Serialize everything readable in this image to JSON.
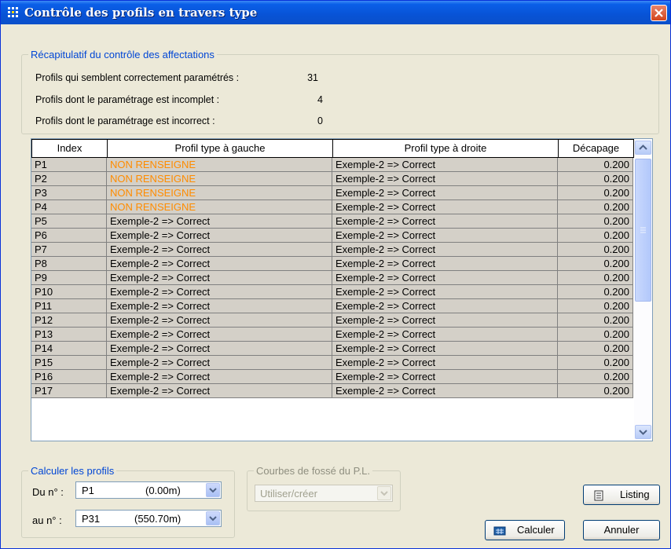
{
  "window": {
    "title": "Contrôle des profils en travers type",
    "accent": "#0a5fe8"
  },
  "summary": {
    "legend": "Récapitulatif du contrôle des affectations",
    "stats": [
      {
        "label": "Profils qui semblent correctement paramétrés :",
        "value": "31"
      },
      {
        "label": "Profils dont le paramétrage est incomplet   :",
        "value": "4"
      },
      {
        "label": "Profils dont le paramétrage est incorrect   :",
        "value": "0"
      }
    ]
  },
  "table": {
    "columns": [
      "Index",
      "Profil type à gauche",
      "Profil type à droite",
      "Décapage"
    ],
    "rows": [
      {
        "index": "P1",
        "left": "NON RENSEIGNE",
        "right": "Exemple-2 => Correct",
        "dec": "0.200",
        "missing": true
      },
      {
        "index": "P2",
        "left": "NON RENSEIGNE",
        "right": "Exemple-2 => Correct",
        "dec": "0.200",
        "missing": true
      },
      {
        "index": "P3",
        "left": "NON RENSEIGNE",
        "right": "Exemple-2 => Correct",
        "dec": "0.200",
        "missing": true
      },
      {
        "index": "P4",
        "left": "NON RENSEIGNE",
        "right": "Exemple-2 => Correct",
        "dec": "0.200",
        "missing": true
      },
      {
        "index": "P5",
        "left": "Exemple-2 => Correct",
        "right": "Exemple-2 => Correct",
        "dec": "0.200"
      },
      {
        "index": "P6",
        "left": "Exemple-2 => Correct",
        "right": "Exemple-2 => Correct",
        "dec": "0.200"
      },
      {
        "index": "P7",
        "left": "Exemple-2 => Correct",
        "right": "Exemple-2 => Correct",
        "dec": "0.200"
      },
      {
        "index": "P8",
        "left": "Exemple-2 => Correct",
        "right": "Exemple-2 => Correct",
        "dec": "0.200"
      },
      {
        "index": "P9",
        "left": "Exemple-2 => Correct",
        "right": "Exemple-2 => Correct",
        "dec": "0.200"
      },
      {
        "index": "P10",
        "left": "Exemple-2 => Correct",
        "right": "Exemple-2 => Correct",
        "dec": "0.200"
      },
      {
        "index": "P11",
        "left": "Exemple-2 => Correct",
        "right": "Exemple-2 => Correct",
        "dec": "0.200"
      },
      {
        "index": "P12",
        "left": "Exemple-2 => Correct",
        "right": "Exemple-2 => Correct",
        "dec": "0.200"
      },
      {
        "index": "P13",
        "left": "Exemple-2 => Correct",
        "right": "Exemple-2 => Correct",
        "dec": "0.200"
      },
      {
        "index": "P14",
        "left": "Exemple-2 => Correct",
        "right": "Exemple-2 => Correct",
        "dec": "0.200"
      },
      {
        "index": "P15",
        "left": "Exemple-2 => Correct",
        "right": "Exemple-2 => Correct",
        "dec": "0.200"
      },
      {
        "index": "P16",
        "left": "Exemple-2 => Correct",
        "right": "Exemple-2 => Correct",
        "dec": "0.200"
      },
      {
        "index": "P17",
        "left": "Exemple-2 => Correct",
        "right": "Exemple-2 => Correct",
        "dec": "0.200"
      }
    ],
    "missing_color": "#ff8c00"
  },
  "calc": {
    "legend": "Calculer les profils",
    "from_label": "Du n° :",
    "from_profile": "P1",
    "from_distance": "(0.00m)",
    "to_label": "au n° :",
    "to_profile": "P31",
    "to_distance": "(550.70m)"
  },
  "ditch": {
    "legend": "Courbes de fossé du P.L.",
    "value": "Utiliser/créer"
  },
  "buttons": {
    "listing": "Listing",
    "calculer": "Calculer",
    "annuler": "Annuler"
  }
}
